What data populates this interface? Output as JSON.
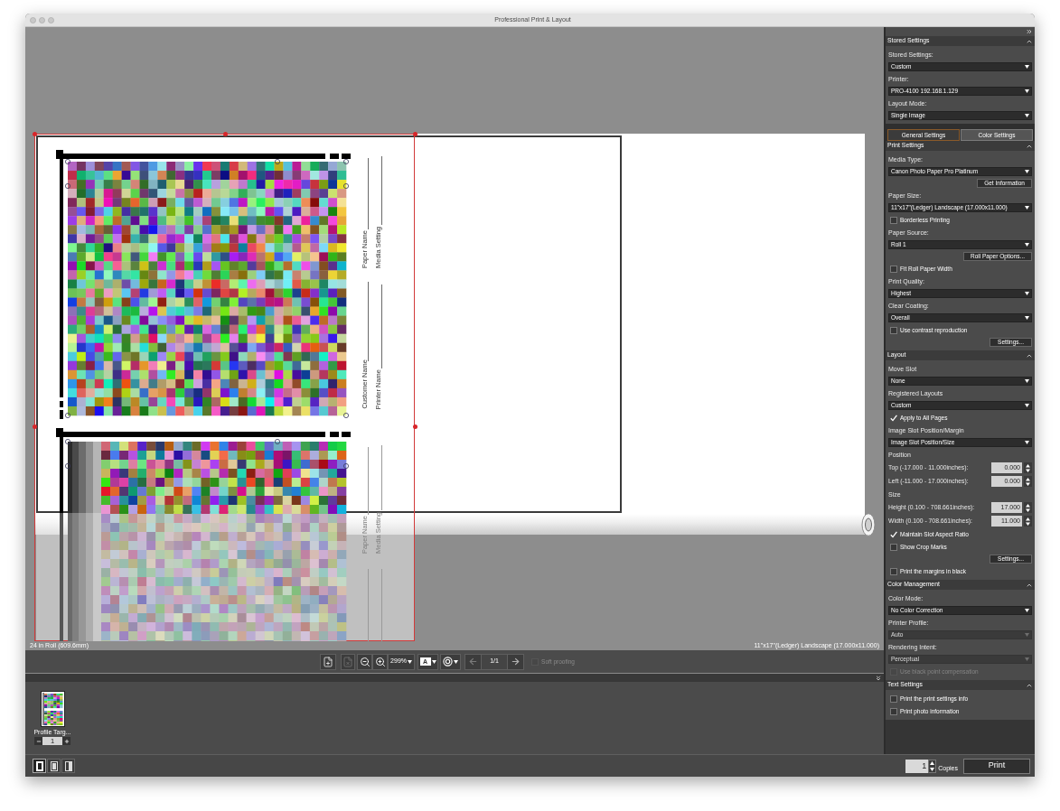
{
  "window": {
    "title": "Professional Print & Layout"
  },
  "preview": {
    "labels": [
      {
        "text": "Paper Name",
        "dimmed": false
      },
      {
        "text": "Media Setting",
        "dimmed": false
      },
      {
        "text": "Customer Name",
        "dimmed": false
      },
      {
        "text": "Printer Name",
        "dimmed": false
      },
      {
        "text": "Paper Name",
        "dimmed": true
      },
      {
        "text": "Media Setting",
        "dimmed": true
      }
    ],
    "roll": "24 in Roll (609.6mm)",
    "paper_size": "11\"x17\"(Ledger) Landscape (17.000x11.000)"
  },
  "toolbar": [
    {
      "kind": "add_page",
      "disabled": false
    },
    {
      "kind": "delete_page",
      "disabled": true
    },
    {
      "kind": "zoom_out",
      "disabled": false
    },
    {
      "kind": "zoom_in",
      "disabled": false
    },
    {
      "kind": "zoom_menu",
      "text": "299%",
      "disabled": false
    },
    {
      "kind": "text_menu",
      "text": "A",
      "disabled": false
    },
    {
      "kind": "color_menu",
      "disabled": false
    },
    {
      "kind": "prev_page",
      "disabled": true
    },
    {
      "kind": "page_indicator",
      "text": "1/1"
    },
    {
      "kind": "next_page",
      "disabled": false
    },
    {
      "kind": "checkbox",
      "text": "Soft proofing",
      "checked": false,
      "disabled": true
    }
  ],
  "thumbnails": [
    {
      "label": "Profile Targ...",
      "copies": "1"
    }
  ],
  "layout_modes": [
    {
      "selected": true
    },
    {
      "selected": false
    },
    {
      "selected": false
    }
  ],
  "copies": {
    "value": "1",
    "label": "Copies"
  },
  "print_button": "Print",
  "panel": {
    "tabs": [
      {
        "label": "General Settings",
        "selected": true
      },
      {
        "label": "Color Settings",
        "selected": false
      }
    ],
    "sections": [
      {
        "title": "Stored Settings",
        "expanded": true,
        "items": [
          {
            "kind": "label",
            "text": "Stored Settings:"
          },
          {
            "kind": "select",
            "value": "Custom",
            "disabled": false
          },
          {
            "kind": "label",
            "text": "Printer:"
          },
          {
            "kind": "select",
            "value": "PRO-4100 192.168.1.129",
            "disabled": false
          },
          {
            "kind": "label",
            "text": "Layout Mode:"
          },
          {
            "kind": "select",
            "value": "Single Image",
            "disabled": false
          }
        ]
      },
      {
        "title": "Print Settings",
        "expanded": true,
        "items": [
          {
            "kind": "label",
            "text": "Media Type:"
          },
          {
            "kind": "select",
            "value": "Canon Photo Paper Pro Platinum",
            "disabled": false
          },
          {
            "kind": "button",
            "text": "Get Information"
          },
          {
            "kind": "label",
            "text": "Paper Size:"
          },
          {
            "kind": "select",
            "value": "11\"x17\"(Ledger) Landscape (17.000x11.000)",
            "disabled": false
          },
          {
            "kind": "checkbox",
            "text": "Borderless Printing",
            "checked": false,
            "disabled": false
          },
          {
            "kind": "label",
            "text": "Paper Source:"
          },
          {
            "kind": "select",
            "value": "Roll 1",
            "disabled": false
          },
          {
            "kind": "button",
            "text": "Roll Paper Options..."
          },
          {
            "kind": "checkbox",
            "text": "Fit Roll Paper Width",
            "checked": false,
            "disabled": false
          },
          {
            "kind": "label",
            "text": "Print Quality:"
          },
          {
            "kind": "select",
            "value": "Highest",
            "disabled": false
          },
          {
            "kind": "label",
            "text": "Clear Coating:"
          },
          {
            "kind": "select",
            "value": "Overall",
            "disabled": false
          },
          {
            "kind": "checkbox",
            "text": "Use contrast reproduction",
            "checked": false,
            "disabled": false
          },
          {
            "kind": "button",
            "text": "Settings..."
          }
        ]
      },
      {
        "title": "Layout",
        "expanded": true,
        "items": [
          {
            "kind": "label",
            "text": "Move Slot"
          },
          {
            "kind": "select",
            "value": "None",
            "disabled": false
          },
          {
            "kind": "label",
            "text": "Registered Layouts"
          },
          {
            "kind": "select",
            "value": "Custom",
            "disabled": false
          },
          {
            "kind": "checkbox",
            "text": "Apply to All Pages",
            "checked": true,
            "disabled": false
          },
          {
            "kind": "label",
            "text": "Image Slot Position/Margin"
          },
          {
            "kind": "select",
            "value": "Image Slot Position/Size",
            "disabled": false
          },
          {
            "kind": "label",
            "text": "Position"
          },
          {
            "kind": "number",
            "text": "Top (-17.000 - 11.000inches):",
            "value": "0.000"
          },
          {
            "kind": "number",
            "text": "Left (-11.000 - 17.000inches):",
            "value": "0.000"
          },
          {
            "kind": "label",
            "text": "Size"
          },
          {
            "kind": "number",
            "text": "Height (0.100 - 708.661inches):",
            "value": "17.000"
          },
          {
            "kind": "number",
            "text": "Width (0.100 - 708.661inches):",
            "value": "11.000"
          },
          {
            "kind": "checkbox",
            "text": "Maintain Slot Aspect Ratio",
            "checked": true,
            "disabled": false
          },
          {
            "kind": "checkbox",
            "text": "Show Crop Marks",
            "checked": false,
            "disabled": false
          },
          {
            "kind": "button",
            "text": "Settings..."
          },
          {
            "kind": "checkbox",
            "text": "Print the margins in black",
            "checked": false,
            "disabled": false
          }
        ]
      },
      {
        "title": "Color Management",
        "expanded": true,
        "items": [
          {
            "kind": "label",
            "text": "Color Mode:"
          },
          {
            "kind": "select",
            "value": "No Color Correction",
            "disabled": false
          },
          {
            "kind": "label",
            "text": "Printer Profile:"
          },
          {
            "kind": "select",
            "value": "Auto",
            "disabled": true
          },
          {
            "kind": "label",
            "text": "Rendering Intent:"
          },
          {
            "kind": "select",
            "value": "Perceptual",
            "disabled": true
          },
          {
            "kind": "checkbox",
            "text": "Use black point compensation",
            "checked": false,
            "disabled": true
          }
        ]
      },
      {
        "title": "Text Settings",
        "expanded": true,
        "items": [
          {
            "kind": "checkbox",
            "text": "Print the print settings info",
            "checked": false,
            "disabled": false
          },
          {
            "kind": "checkbox",
            "text": "Print photo information",
            "checked": false,
            "disabled": false
          }
        ]
      }
    ]
  }
}
